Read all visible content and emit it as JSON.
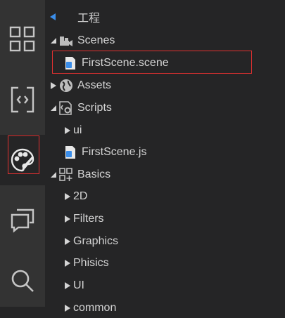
{
  "colors": {
    "activity_bar_bg": "#333333",
    "sidebar_bg": "#252526",
    "icon_fg": "#c5c5c5",
    "text": "#d4d4d4",
    "accent_blue": "#3b8eea",
    "highlight_red": "#e03030"
  },
  "activity_bar": {
    "items": [
      {
        "icon": "grid-icon"
      },
      {
        "icon": "code-brackets-icon"
      },
      {
        "icon": "palette-icon",
        "active": true
      },
      {
        "icon": "chat-icon"
      },
      {
        "icon": "search-icon"
      }
    ]
  },
  "panel": {
    "header_title": "工程",
    "tree": {
      "scenes": {
        "label": "Scenes",
        "icon": "scene-camera-icon"
      },
      "first_scene_file": {
        "label": "FirstScene.scene",
        "icon": "file-icon"
      },
      "assets": {
        "label": "Assets",
        "icon": "globe-icon"
      },
      "scripts": {
        "label": "Scripts",
        "icon": "script-gear-icon"
      },
      "ui": {
        "label": "ui"
      },
      "first_scene_js": {
        "label": "FirstScene.js",
        "icon": "file-icon"
      },
      "basics": {
        "label": "Basics",
        "icon": "blocks-icon"
      },
      "basics_children": [
        "2D",
        "Filters",
        "Graphics",
        "Phisics",
        "UI",
        "common"
      ]
    }
  }
}
